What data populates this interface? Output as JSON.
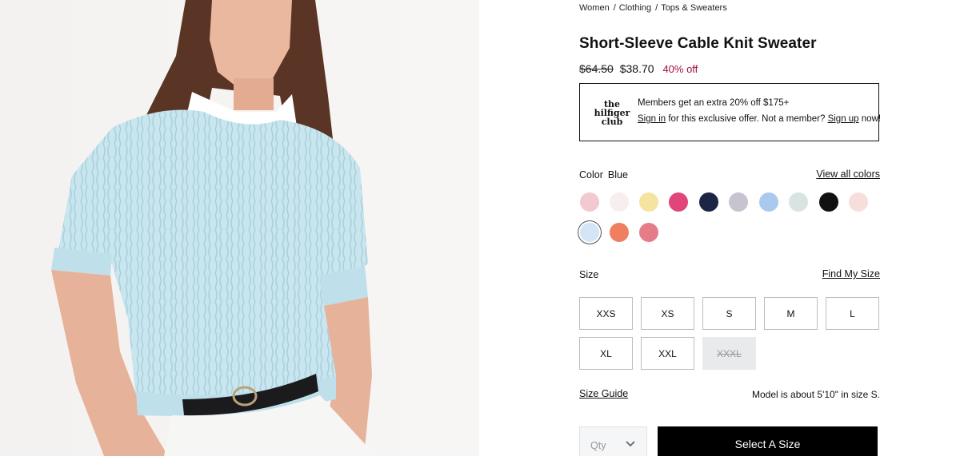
{
  "breadcrumb": [
    "Women",
    "Clothing",
    "Tops & Sweaters"
  ],
  "product": {
    "title": "Short-Sleeve Cable Knit Sweater",
    "original_price": "$64.50",
    "sale_price": "$38.70",
    "discount": "40% off"
  },
  "promo": {
    "logo_lines": [
      "the",
      "hilfiger",
      "club"
    ],
    "line1": "Members get an extra 20% off $175+",
    "sign_in": "Sign in",
    "line2_mid": " for this exclusive offer. Not a member? ",
    "sign_up": "Sign up",
    "line2_end": " now!"
  },
  "color": {
    "label": "Color",
    "selected": "Blue",
    "view_all": "View all colors",
    "swatches": [
      {
        "name": "light-pink",
        "color": "#f1c9cf"
      },
      {
        "name": "white",
        "color": "#f7eeee"
      },
      {
        "name": "yellow",
        "color": "#f5e3a0"
      },
      {
        "name": "hot-pink",
        "color": "#e0467a"
      },
      {
        "name": "navy",
        "color": "#1c2544"
      },
      {
        "name": "grey-marl",
        "color": "#c7c3cf"
      },
      {
        "name": "light-blue",
        "color": "#a9c9ee"
      },
      {
        "name": "mint-grey",
        "color": "#d9e4e2"
      },
      {
        "name": "black",
        "color": "#111111"
      },
      {
        "name": "blush",
        "color": "#f6dedd"
      },
      {
        "name": "blue",
        "color": "#d4e6f5"
      },
      {
        "name": "coral",
        "color": "#ef7f60"
      },
      {
        "name": "rose",
        "color": "#e77c89"
      }
    ]
  },
  "size": {
    "label": "Size",
    "find_my_size": "Find My Size",
    "options": [
      {
        "label": "XXS",
        "available": true
      },
      {
        "label": "XS",
        "available": true
      },
      {
        "label": "S",
        "available": true
      },
      {
        "label": "M",
        "available": true
      },
      {
        "label": "L",
        "available": true
      },
      {
        "label": "XL",
        "available": true
      },
      {
        "label": "XXL",
        "available": true
      },
      {
        "label": "XXXL",
        "available": false
      }
    ],
    "guide": "Size Guide",
    "model_note": "Model is about 5'10\" in size S."
  },
  "purchase": {
    "qty_label": "Qty",
    "cta": "Select A Size"
  }
}
